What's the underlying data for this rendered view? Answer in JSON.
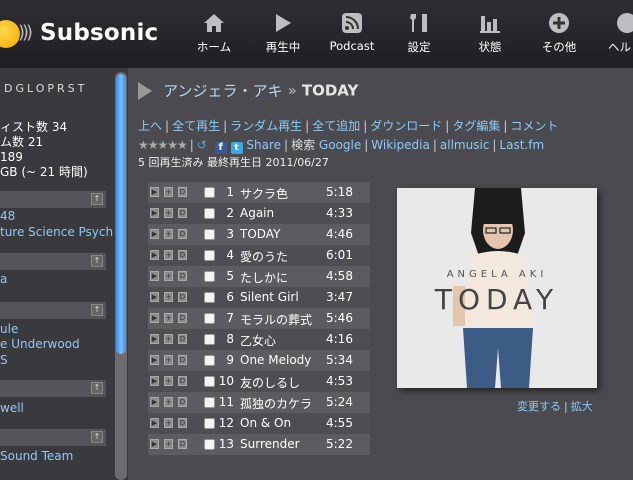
{
  "app": {
    "name": "Subsonic"
  },
  "nav": [
    {
      "label": "ホーム",
      "icon": "home-icon"
    },
    {
      "label": "再生中",
      "icon": "play-icon"
    },
    {
      "label": "Podcast",
      "icon": "podcast-icon"
    },
    {
      "label": "設定",
      "icon": "settings-icon"
    },
    {
      "label": "状態",
      "icon": "status-icon"
    },
    {
      "label": "その他",
      "icon": "more-icon"
    },
    {
      "label": "ヘル",
      "icon": "help-icon"
    }
  ],
  "sidebar": {
    "index": "DGLOPRST",
    "stats": [
      "ィスト数 34",
      "ム数 21",
      "189",
      "GB (~ 21 時間)"
    ],
    "artists": [
      "48",
      "ture Science Psych",
      "a",
      "ule",
      "e Underwood",
      "S",
      "well",
      "Sound Team"
    ]
  },
  "album": {
    "artist": "アンジェラ・アキ",
    "separator": "»",
    "title": "TODAY",
    "rating_stars": "★★★★★",
    "plays": "5 回再生済み 最終再生日 2011/06/27",
    "cover_name": "ANGELA AKI",
    "cover_title": "TODAY"
  },
  "links": {
    "up": "上へ",
    "play_all": "全て再生",
    "random": "ランダム再生",
    "add_all": "全て追加",
    "download": "ダウンロード",
    "edit_tags": "タグ編集",
    "comment": "コメント",
    "share": "Share",
    "search_label": "検索",
    "google": "Google",
    "wikipedia": "Wikipedia",
    "allmusic": "allmusic",
    "lastfm": "Last.fm",
    "change": "変更する",
    "zoom": "拡大"
  },
  "track_controls": {
    "play": "▶",
    "add": "+",
    "download": "D"
  },
  "tracks": [
    {
      "num": "1",
      "title": "サクラ色",
      "duration": "5:18"
    },
    {
      "num": "2",
      "title": "Again",
      "duration": "4:33"
    },
    {
      "num": "3",
      "title": "TODAY",
      "duration": "4:46"
    },
    {
      "num": "4",
      "title": "愛のうた",
      "duration": "6:01"
    },
    {
      "num": "5",
      "title": "たしかに",
      "duration": "4:58"
    },
    {
      "num": "6",
      "title": "Silent Girl",
      "duration": "3:47"
    },
    {
      "num": "7",
      "title": "モラルの葬式",
      "duration": "5:46"
    },
    {
      "num": "8",
      "title": "乙女心",
      "duration": "4:16"
    },
    {
      "num": "9",
      "title": "One Melody",
      "duration": "5:34"
    },
    {
      "num": "10",
      "title": "友のしるし",
      "duration": "4:53"
    },
    {
      "num": "11",
      "title": "孤独のカケラ",
      "duration": "5:24"
    },
    {
      "num": "12",
      "title": "On & On",
      "duration": "4:55"
    },
    {
      "num": "13",
      "title": "Surrender",
      "duration": "5:22"
    }
  ]
}
